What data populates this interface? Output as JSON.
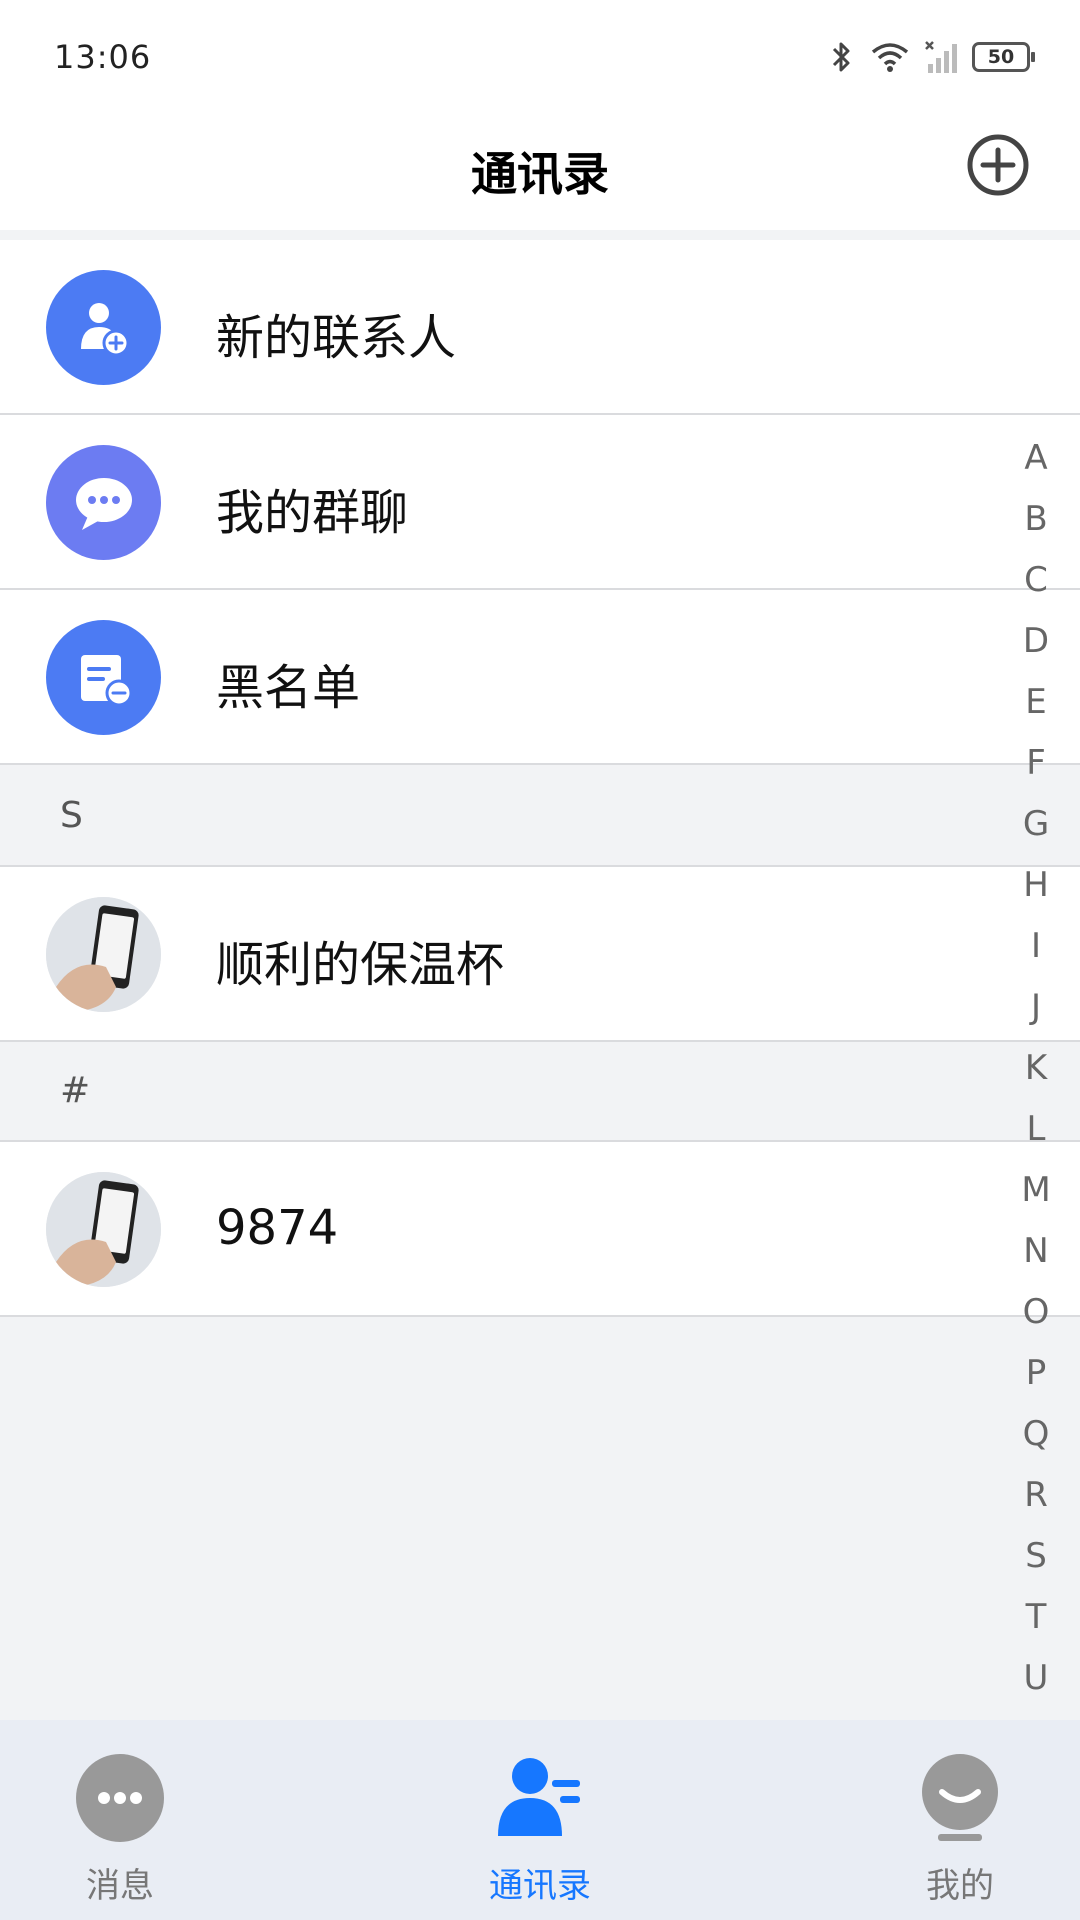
{
  "status_bar": {
    "time": "13:06",
    "battery": "50",
    "icons": [
      "bluetooth-icon",
      "wifi-icon",
      "signal-icon",
      "battery-icon"
    ]
  },
  "header": {
    "title": "通讯录",
    "action_icon": "plus-circle-icon"
  },
  "function_items": [
    {
      "label": "新的联系人",
      "icon": "add-user-icon",
      "color": "#4c7bf3"
    },
    {
      "label": "我的群聊",
      "icon": "chat-bubble-icon",
      "color": "#6c7cf2"
    },
    {
      "label": "黑名单",
      "icon": "blacklist-icon",
      "color": "#4c7bf3"
    }
  ],
  "sections": [
    {
      "letter": "S",
      "contacts": [
        {
          "name": "顺利的保温杯",
          "avatar": "phone-photo-avatar"
        }
      ]
    },
    {
      "letter": "#",
      "contacts": [
        {
          "name": "9874",
          "avatar": "phone-photo-avatar"
        }
      ]
    }
  ],
  "alphabet_index": [
    "A",
    "B",
    "C",
    "D",
    "E",
    "F",
    "G",
    "H",
    "I",
    "J",
    "K",
    "L",
    "M",
    "N",
    "O",
    "P",
    "Q",
    "R",
    "S",
    "T",
    "U"
  ],
  "tabbar": {
    "tabs": [
      {
        "label": "消息",
        "icon": "message-icon",
        "active": false
      },
      {
        "label": "通讯录",
        "icon": "contacts-icon",
        "active": true
      },
      {
        "label": "我的",
        "icon": "profile-icon",
        "active": false
      }
    ],
    "active_color": "#1677ff",
    "inactive_color": "#999999"
  }
}
